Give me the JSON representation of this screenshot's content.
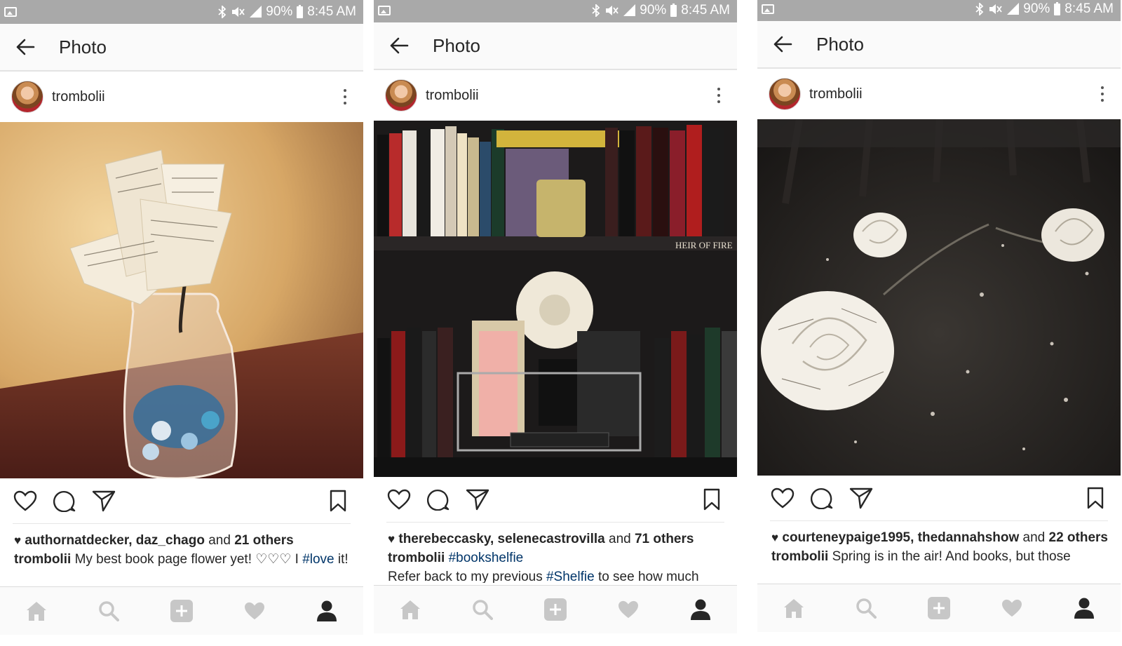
{
  "status_bar": {
    "battery": "90%",
    "time": "8:45 AM"
  },
  "app_bar": {
    "title": "Photo"
  },
  "colors": {
    "status_bar_bg": "#a9a9a9",
    "hashtag": "#003569",
    "nav_icon": "#c7c7c7",
    "nav_active": "#262626"
  },
  "icons": {
    "status": [
      "image-notification-icon",
      "bluetooth-icon",
      "mute-icon",
      "lte-signal-icon",
      "battery-icon"
    ],
    "app_bar": "back-arrow-icon",
    "post_actions": [
      "heart-icon",
      "comment-icon",
      "share-icon",
      "bookmark-icon"
    ],
    "bottom_nav": [
      "home-icon",
      "search-icon",
      "add-icon",
      "activity-heart-icon",
      "profile-icon"
    ]
  },
  "posts": [
    {
      "username": "trombolii",
      "likes": {
        "users": "authornatdecker, daz_chago",
        "and": "and",
        "count": "21 others"
      },
      "caption": {
        "user": "trombolii",
        "text": "My best book page flower yet! ♡♡♡ I",
        "tag": "#love",
        "after": "it!"
      }
    },
    {
      "username": "trombolii",
      "likes": {
        "users": "therebeccasky, selenecastrovilla",
        "and": "and",
        "count": "71 others"
      },
      "caption": {
        "user": "trombolii",
        "tag": "#bookshelfie",
        "line2_before": "Refer back to my previous",
        "line2_tag": "#Shelfie",
        "line2_after": "to see how much"
      }
    },
    {
      "username": "trombolii",
      "likes": {
        "users": "courteneypaige1995, thedannahshow",
        "and": "and",
        "count": "22 others"
      },
      "caption": {
        "user": "trombolii",
        "text": "Spring is in the air! And books, but those"
      }
    }
  ]
}
